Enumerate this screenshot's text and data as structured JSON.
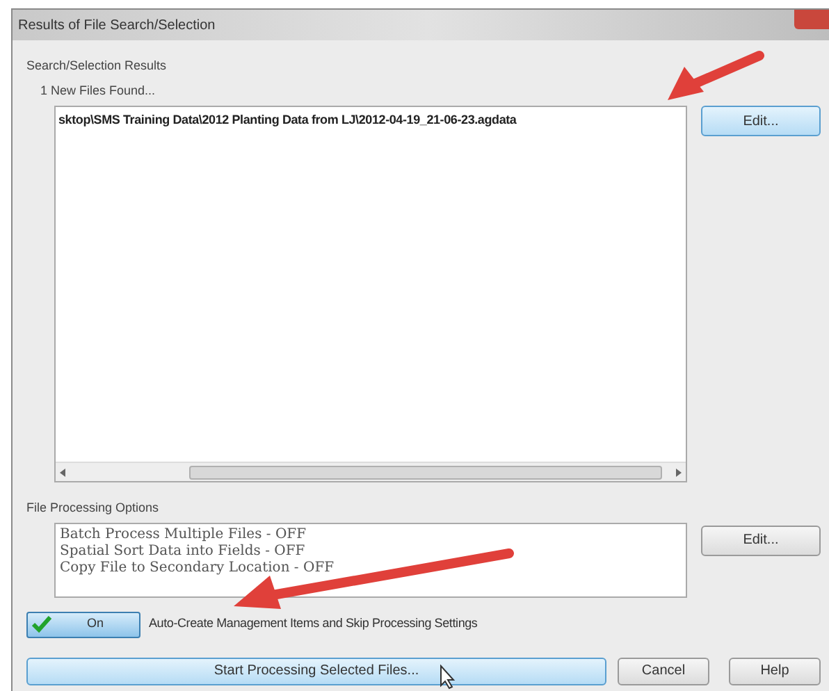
{
  "window": {
    "title": "Results of File Search/Selection"
  },
  "results": {
    "label": "Search/Selection Results",
    "count_text": "1 New Files Found...",
    "files": [
      "sktop\\SMS Training Data\\2012 Planting Data from LJ\\2012-04-19_21-06-23.agdata"
    ],
    "edit_button": "Edit..."
  },
  "processing": {
    "label": "File Processing Options",
    "options": [
      "Batch Process Multiple Files - OFF",
      "Spatial Sort Data into Fields - OFF",
      "Copy File to Secondary Location - OFF"
    ],
    "edit_button": "Edit..."
  },
  "auto_create": {
    "toggle_label": "On",
    "on": true,
    "label": "Auto-Create Management Items and Skip Processing Settings"
  },
  "buttons": [
    "Start Processing Selected Files...",
    "Cancel",
    "Help"
  ]
}
